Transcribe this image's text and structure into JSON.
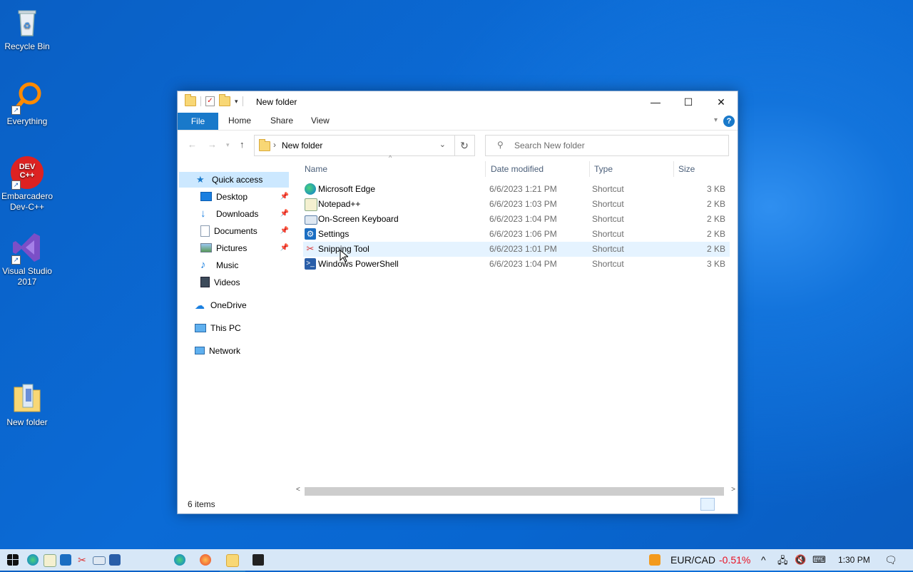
{
  "desktop": {
    "icons": [
      {
        "label": "Recycle Bin"
      },
      {
        "label": "Everything"
      },
      {
        "label": "Embarcadero Dev-C++",
        "badge": "DEV C++"
      },
      {
        "label": "Visual Studio 2017"
      },
      {
        "label": "New folder"
      }
    ]
  },
  "window": {
    "title": "New folder",
    "ribbon_tabs": [
      "File",
      "Home",
      "Share",
      "View"
    ],
    "address": {
      "crumb": "New folder"
    },
    "search_placeholder": "Search New folder",
    "nav": {
      "quick_access": "Quick access",
      "items": [
        "Desktop",
        "Downloads",
        "Documents",
        "Pictures",
        "Music",
        "Videos"
      ],
      "onedrive": "OneDrive",
      "this_pc": "This PC",
      "network": "Network"
    },
    "columns": [
      "Name",
      "Date modified",
      "Type",
      "Size"
    ],
    "files": [
      {
        "name": "Microsoft Edge",
        "date": "6/6/2023 1:21 PM",
        "type": "Shortcut",
        "size": "3 KB",
        "icon": "edge-icon"
      },
      {
        "name": "Notepad++",
        "date": "6/6/2023 1:03 PM",
        "type": "Shortcut",
        "size": "2 KB",
        "icon": "notepad-plus-plus-icon"
      },
      {
        "name": "On-Screen Keyboard",
        "date": "6/6/2023 1:04 PM",
        "type": "Shortcut",
        "size": "2 KB",
        "icon": "keyboard-icon"
      },
      {
        "name": "Settings",
        "date": "6/6/2023 1:06 PM",
        "type": "Shortcut",
        "size": "2 KB",
        "icon": "gear-icon"
      },
      {
        "name": "Snipping Tool",
        "date": "6/6/2023 1:01 PM",
        "type": "Shortcut",
        "size": "2 KB",
        "icon": "scissors-icon"
      },
      {
        "name": "Windows PowerShell",
        "date": "6/6/2023 1:04 PM",
        "type": "Shortcut",
        "size": "3 KB",
        "icon": "powershell-icon"
      }
    ],
    "status": "6 items"
  },
  "taskbar": {
    "ticker_pair": "EUR/CAD",
    "ticker_change": "-0.51%",
    "time": "1:30 PM"
  },
  "colors": {
    "accent": "#1979ca",
    "selection": "#e5f3ff",
    "negative": "#e81123"
  }
}
